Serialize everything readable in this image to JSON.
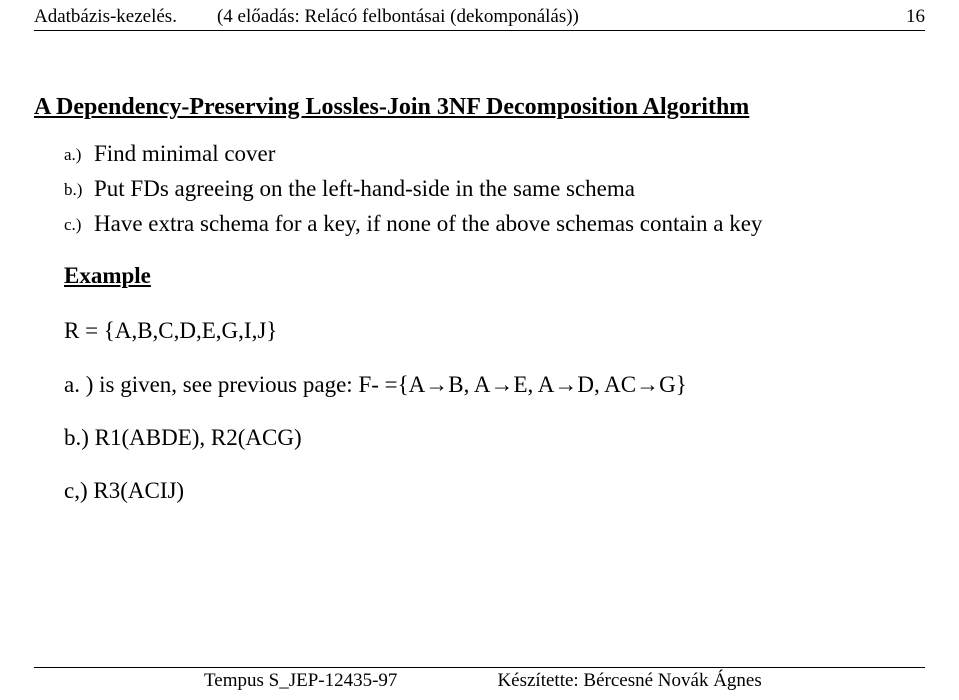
{
  "header": {
    "left": "Adatbázis-kezelés.",
    "center": "(4 előadás: Relácó felbontásai (dekomponálás))",
    "page_no": "16"
  },
  "title": "A Dependency-Preserving Lossles-Join 3NF Decomposition Algorithm",
  "steps": {
    "a_label": "a.)",
    "a_text": "Find minimal cover",
    "b_label": "b.)",
    "b_text": "Put FDs agreeing on the left-hand-side in the same schema",
    "c_label": "c.)",
    "c_text": "Have extra schema for a key, if none of the above schemas contain a key"
  },
  "example_heading": "Example",
  "example": {
    "relation": "R = {A,B,C,D,E,G,I,J}",
    "line_a": "a. ) is given, see previous page:  F- ={A→B, A→E,  A→D, AC→G}",
    "line_b": "b.) R1(ABDE), R2(ACG)",
    "line_c": "c,) R3(ACIJ)"
  },
  "footer": {
    "left": "Tempus S_JEP-12435-97",
    "right": "Készítette: Bércesné Novák Ágnes"
  }
}
